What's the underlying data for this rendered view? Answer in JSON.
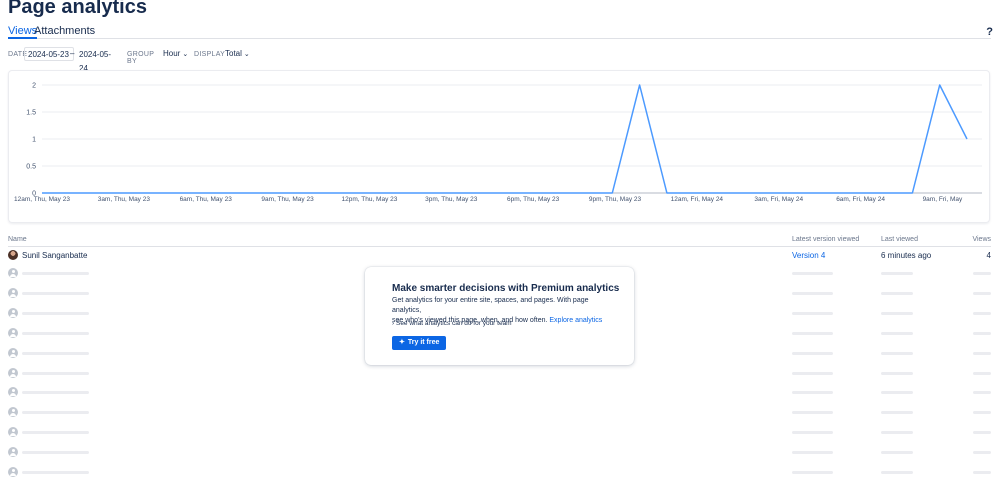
{
  "page": {
    "title": "Page analytics",
    "help_label": "?"
  },
  "tabs": [
    {
      "label": "Views"
    },
    {
      "label": "Attachments"
    }
  ],
  "filters": {
    "date_label": "DATE",
    "date_from": "2024-05-23",
    "date_separator": "–",
    "date_to": "2024-05-24",
    "group_by_label": "GROUP BY",
    "group_by_value": "Hour",
    "display_label": "DISPLAY",
    "display_value": "Total"
  },
  "chart_data": {
    "type": "line",
    "title": "",
    "xlabel": "",
    "ylabel": "",
    "ylim": [
      0,
      2
    ],
    "y_ticks": [
      "0",
      "0.5",
      "1",
      "1.5",
      "2"
    ],
    "grid": true,
    "color": "#4c9aff",
    "x_tick_labels": [
      "12am, Thu, May 23",
      "3am, Thu, May 23",
      "6am, Thu, May 23",
      "9am, Thu, May 23",
      "12pm, Thu, May 23",
      "3pm, Thu, May 23",
      "6pm, Thu, May 23",
      "9pm, Thu, May 23",
      "12am, Fri, May 24",
      "3am, Fri, May 24",
      "6am, Fri, May 24",
      "9am, Fri, May"
    ],
    "x_hours": [
      0,
      1,
      2,
      3,
      4,
      5,
      6,
      7,
      8,
      9,
      10,
      11,
      12,
      13,
      14,
      15,
      16,
      17,
      17.9,
      18.9,
      19.9,
      20.9,
      21.9,
      22.9,
      23.9,
      24.9,
      25.9,
      26.9,
      27.9,
      28.9,
      29.9,
      30.9,
      31.9,
      32.9,
      33.9
    ],
    "values": [
      0,
      0,
      0,
      0,
      0,
      0,
      0,
      0,
      0,
      0,
      0,
      0,
      0,
      0,
      0,
      0,
      0,
      0,
      0,
      0,
      0,
      0,
      2,
      0,
      0,
      0,
      0,
      0,
      0,
      0,
      0,
      0,
      0,
      2,
      1
    ]
  },
  "table": {
    "headers": {
      "name": "Name",
      "version": "Latest version viewed",
      "last": "Last viewed",
      "views": "Views"
    },
    "first_row": {
      "name": "Sunil Sanganbatte",
      "version": "Version 4",
      "last": "6 minutes ago",
      "views": "4"
    },
    "placeholder_rows": 11
  },
  "promo": {
    "title": "Make smarter decisions with Premium analytics",
    "body_line1": "Get analytics for your entire site, spaces, and pages. With page analytics,",
    "body_line2": "see who's viewed this page, when, and how often.",
    "link": "Explore analytics",
    "more": "See what analytics can do for your team",
    "button": "Try it free"
  }
}
